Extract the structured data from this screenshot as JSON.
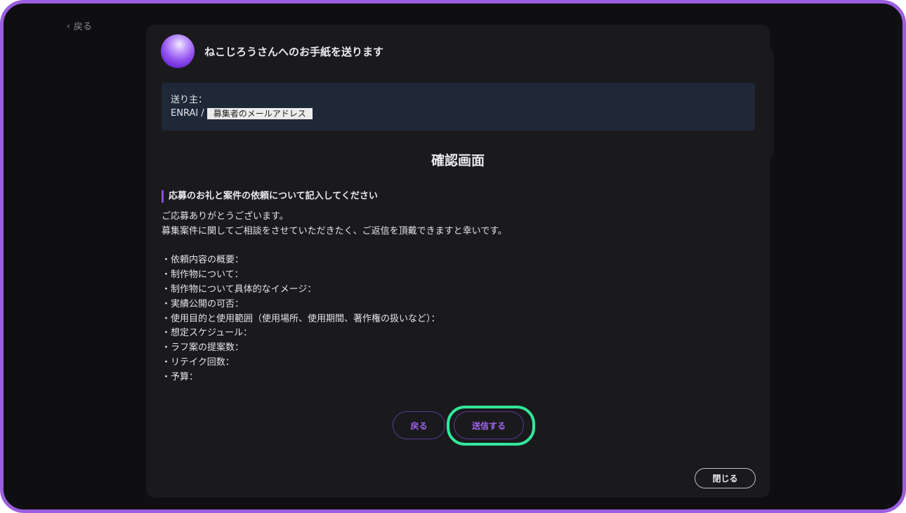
{
  "nav": {
    "back_label": "戻る"
  },
  "modal": {
    "title": "ねこじろうさんへのお手紙を送ります",
    "sender": {
      "label": "送り主：",
      "name": "ENRAI /",
      "email_placeholder": "募集者のメールアドレス"
    },
    "section_title": "確認画面",
    "message_heading": "応募のお礼と案件の依頼について記入してください",
    "message_lines": [
      "ご応募ありがとうございます。",
      "募集案件に関してご相談をさせていただきたく、ご返信を頂戴できますと幸いです。",
      "",
      "・依頼内容の概要：",
      "・制作物について：",
      "・制作物について具体的なイメージ：",
      "・実績公開の可否：",
      "・使用目的と使用範囲（使用場所、使用期間、著作権の扱いなど）：",
      "・想定スケジュール：",
      "・ラフ案の提案数：",
      "・リテイク回数：",
      "・予算："
    ],
    "back_button": "戻る",
    "send_button": "送信する",
    "close_button": "閉じる"
  },
  "colors": {
    "accent": "#9b63ee",
    "highlight": "#31e89a",
    "frame": "#9c5ee0"
  }
}
